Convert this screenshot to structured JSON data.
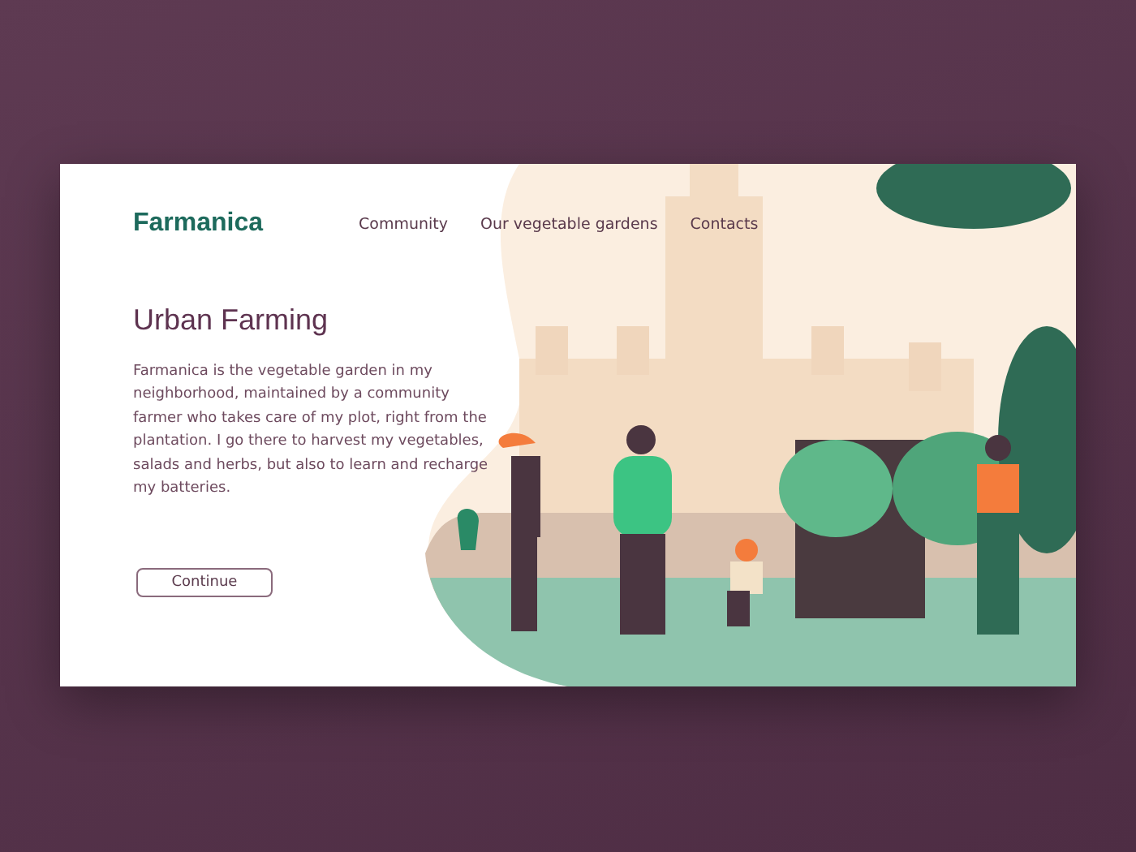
{
  "logo": "Farmanica",
  "nav": [
    {
      "label": "Community"
    },
    {
      "label": "Our vegetable gardens"
    },
    {
      "label": "Contacts"
    }
  ],
  "hero": {
    "title": "Urban Farming",
    "text": "Farmanica is the vegetable garden in my neighborhood, maintained by a community farmer who takes care of my plot, right from the plantation. I go there to harvest my vegetables, salads and herbs, but also to learn and recharge my batteries.",
    "button": "Continue"
  }
}
